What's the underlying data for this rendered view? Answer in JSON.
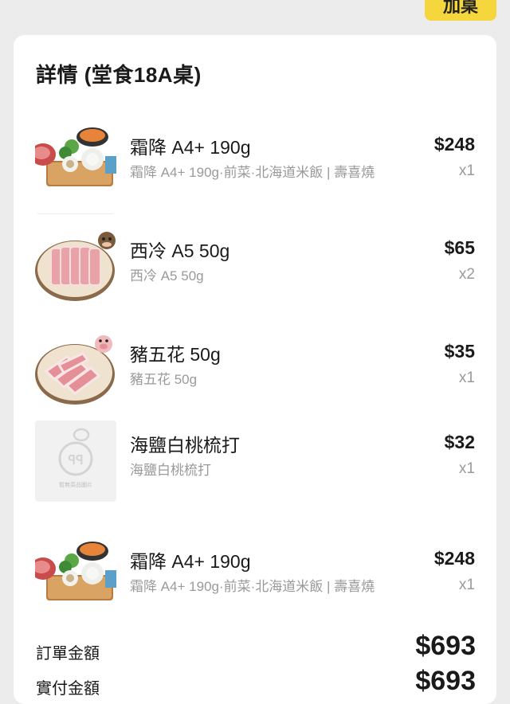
{
  "header": {
    "add_button_label": "加桌"
  },
  "details": {
    "title": "詳情 (堂食18A桌)",
    "items": [
      {
        "name": "霜降 A4+ 190g",
        "description": "霜降 A4+ 190g·前菜·北海道米飯 | 壽喜燒",
        "price": "$248",
        "quantity": "x1",
        "image_icon": "sukiyaki-set-icon"
      },
      {
        "name": "西冷 A5 50g",
        "description": "西冷 A5 50g",
        "price": "$65",
        "quantity": "x2",
        "image_icon": "beef-plate-icon"
      },
      {
        "name": "豬五花 50g",
        "description": "豬五花 50g",
        "price": "$35",
        "quantity": "x1",
        "image_icon": "pork-plate-icon"
      },
      {
        "name": "海鹽白桃梳打",
        "description": "海鹽白桃梳打",
        "price": "$32",
        "quantity": "x1",
        "image_icon": "placeholder-image-icon",
        "placeholder_caption": "暫無菜品圖片"
      },
      {
        "name": "霜降 A4+ 190g",
        "description": "霜降 A4+ 190g·前菜·北海道米飯 | 壽喜燒",
        "price": "$248",
        "quantity": "x1",
        "image_icon": "sukiyaki-set-icon"
      }
    ]
  },
  "summary": {
    "order_amount_label": "訂單金額",
    "order_amount_value": "$693",
    "paid_amount_label": "實付金額",
    "paid_amount_value": "$693"
  },
  "colors": {
    "accent": "#f5d63d",
    "background": "#ececec",
    "card": "#ffffff",
    "muted_text": "#9a9a9a"
  }
}
